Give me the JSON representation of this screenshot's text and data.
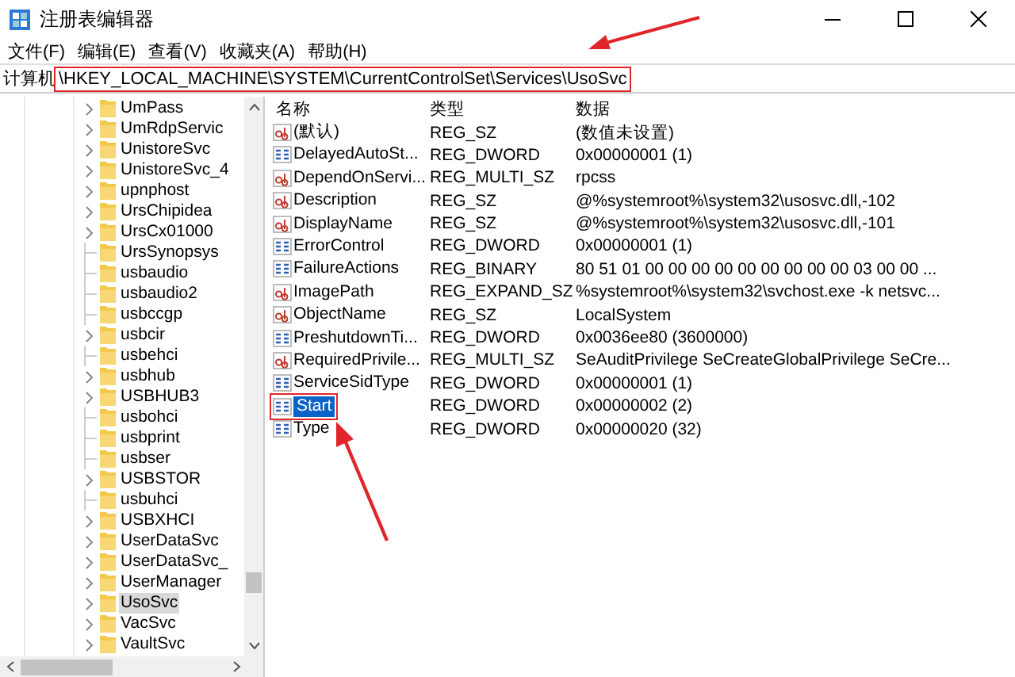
{
  "window": {
    "title": "注册表编辑器"
  },
  "menu": [
    {
      "label": "文件(F)"
    },
    {
      "label": "编辑(E)"
    },
    {
      "label": "查看(V)"
    },
    {
      "label": "收藏夹(A)"
    },
    {
      "label": "帮助(H)"
    }
  ],
  "address": {
    "label": "计算机",
    "path": "\\HKEY_LOCAL_MACHINE\\SYSTEM\\CurrentControlSet\\Services\\UsoSvc",
    "highlighted": true
  },
  "tree": [
    {
      "label": "UmPass",
      "has_children": true,
      "selected": false
    },
    {
      "label": "UmRdpServic",
      "has_children": true,
      "selected": false
    },
    {
      "label": "UnistoreSvc",
      "has_children": true,
      "selected": false
    },
    {
      "label": "UnistoreSvc_4",
      "has_children": true,
      "selected": false
    },
    {
      "label": "upnphost",
      "has_children": true,
      "selected": false
    },
    {
      "label": "UrsChipidea",
      "has_children": true,
      "selected": false
    },
    {
      "label": "UrsCx01000",
      "has_children": true,
      "selected": false
    },
    {
      "label": "UrsSynopsys",
      "has_children": false,
      "selected": false
    },
    {
      "label": "usbaudio",
      "has_children": false,
      "selected": false
    },
    {
      "label": "usbaudio2",
      "has_children": false,
      "selected": false
    },
    {
      "label": "usbccgp",
      "has_children": false,
      "selected": false
    },
    {
      "label": "usbcir",
      "has_children": true,
      "selected": false
    },
    {
      "label": "usbehci",
      "has_children": false,
      "selected": false
    },
    {
      "label": "usbhub",
      "has_children": true,
      "selected": false
    },
    {
      "label": "USBHUB3",
      "has_children": true,
      "selected": false
    },
    {
      "label": "usbohci",
      "has_children": false,
      "selected": false
    },
    {
      "label": "usbprint",
      "has_children": false,
      "selected": false
    },
    {
      "label": "usbser",
      "has_children": false,
      "selected": false
    },
    {
      "label": "USBSTOR",
      "has_children": true,
      "selected": false
    },
    {
      "label": "usbuhci",
      "has_children": false,
      "selected": false
    },
    {
      "label": "USBXHCI",
      "has_children": true,
      "selected": false
    },
    {
      "label": "UserDataSvc",
      "has_children": true,
      "selected": false
    },
    {
      "label": "UserDataSvc_",
      "has_children": true,
      "selected": false
    },
    {
      "label": "UserManager",
      "has_children": true,
      "selected": false
    },
    {
      "label": "UsoSvc",
      "has_children": true,
      "selected": true
    },
    {
      "label": "VacSvc",
      "has_children": true,
      "selected": false
    },
    {
      "label": "VaultSvc",
      "has_children": true,
      "selected": false
    }
  ],
  "values": {
    "columns": [
      "名称",
      "类型",
      "数据"
    ],
    "rows": [
      {
        "kind": "string",
        "name": "(默认)",
        "type": "REG_SZ",
        "data": "(数值未设置)",
        "selected": false,
        "highlighted": false
      },
      {
        "kind": "binary",
        "name": "DelayedAutoSt...",
        "type": "REG_DWORD",
        "data": "0x00000001 (1)",
        "selected": false,
        "highlighted": false
      },
      {
        "kind": "string",
        "name": "DependOnServi...",
        "type": "REG_MULTI_SZ",
        "data": "rpcss",
        "selected": false,
        "highlighted": false
      },
      {
        "kind": "string",
        "name": "Description",
        "type": "REG_SZ",
        "data": "@%systemroot%\\system32\\usosvc.dll,-102",
        "selected": false,
        "highlighted": false
      },
      {
        "kind": "string",
        "name": "DisplayName",
        "type": "REG_SZ",
        "data": "@%systemroot%\\system32\\usosvc.dll,-101",
        "selected": false,
        "highlighted": false
      },
      {
        "kind": "binary",
        "name": "ErrorControl",
        "type": "REG_DWORD",
        "data": "0x00000001 (1)",
        "selected": false,
        "highlighted": false
      },
      {
        "kind": "binary",
        "name": "FailureActions",
        "type": "REG_BINARY",
        "data": "80 51 01 00 00 00 00 00 00 00 00 00 03 00 00 ...",
        "selected": false,
        "highlighted": false
      },
      {
        "kind": "string",
        "name": "ImagePath",
        "type": "REG_EXPAND_SZ",
        "data": "%systemroot%\\system32\\svchost.exe -k netsvc...",
        "selected": false,
        "highlighted": false
      },
      {
        "kind": "string",
        "name": "ObjectName",
        "type": "REG_SZ",
        "data": "LocalSystem",
        "selected": false,
        "highlighted": false
      },
      {
        "kind": "binary",
        "name": "PreshutdownTi...",
        "type": "REG_DWORD",
        "data": "0x0036ee80 (3600000)",
        "selected": false,
        "highlighted": false
      },
      {
        "kind": "string",
        "name": "RequiredPrivile...",
        "type": "REG_MULTI_SZ",
        "data": "SeAuditPrivilege SeCreateGlobalPrivilege SeCre...",
        "selected": false,
        "highlighted": false
      },
      {
        "kind": "binary",
        "name": "ServiceSidType",
        "type": "REG_DWORD",
        "data": "0x00000001 (1)",
        "selected": false,
        "highlighted": false
      },
      {
        "kind": "binary",
        "name": "Start",
        "type": "REG_DWORD",
        "data": "0x00000002 (2)",
        "selected": true,
        "highlighted": true
      },
      {
        "kind": "binary",
        "name": "Type",
        "type": "REG_DWORD",
        "data": "0x00000020 (32)",
        "selected": false,
        "highlighted": false
      }
    ]
  }
}
